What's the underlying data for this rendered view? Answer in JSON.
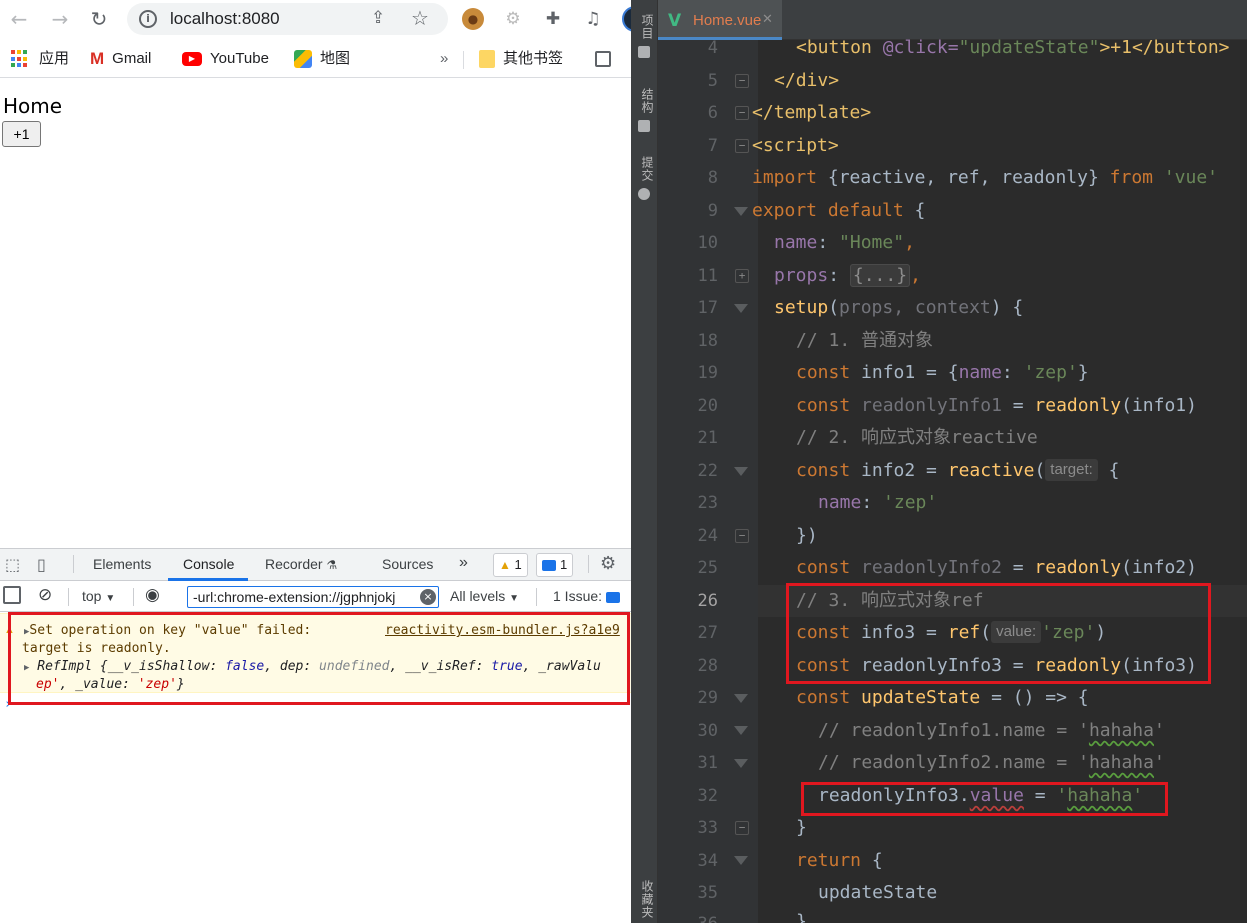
{
  "browser": {
    "url": "localhost:8080",
    "bookmarks": [
      "应用",
      "Gmail",
      "YouTube",
      "地图",
      "其他书签"
    ],
    "overflow_glyph": "»",
    "page": {
      "heading": "Home",
      "button_label": "+1"
    }
  },
  "devtools": {
    "tabs": [
      "Elements",
      "Console",
      "Recorder",
      "Sources"
    ],
    "active_tab": "Console",
    "more_glyph": "»",
    "warnings_count": "1",
    "messages_count": "1",
    "context": "top",
    "filter_value": "-url:chrome-extension://jgphnjokj",
    "levels": "All levels",
    "issues": "1 Issue:",
    "console": {
      "line1": "Set operation on key \"value\" failed:",
      "source": "reactivity.esm-bundler.js?a1e9",
      "line2": "target is readonly.",
      "obj_prefix": "RefImpl {",
      "obj_k1": "__v_isShallow: ",
      "obj_v1": "false",
      "obj_k2": ", dep: ",
      "obj_v2": "undefined",
      "obj_k3": ", __v_isRef: ",
      "obj_v3": "true",
      "obj_k4": ", _rawValu",
      "obj_cont_str": "ep'",
      "obj_cont_k": ", _value: ",
      "obj_cont_v": "'zep'",
      "obj_close": "}"
    }
  },
  "ide": {
    "side_labels": [
      "项目",
      "结构",
      "提交",
      "收藏夹"
    ],
    "file_tab": "Home.vue",
    "line_numbers": [
      "4",
      "5",
      "6",
      "7",
      "8",
      "9",
      "10",
      "11",
      "17",
      "18",
      "19",
      "20",
      "21",
      "22",
      "23",
      "24",
      "25",
      "26",
      "27",
      "28",
      "29",
      "30",
      "31",
      "32",
      "33",
      "34",
      "35",
      "36"
    ],
    "code": {
      "l4_a": "<button ",
      "l4_b": "@click=",
      "l4_c": "\"updateState\"",
      "l4_d": ">+1</",
      "l4_e": "button",
      "l4_f": ">",
      "l5_a": "</",
      "l5_b": "div",
      "l5_c": ">",
      "l6_a": "</",
      "l6_b": "template",
      "l6_c": ">",
      "l7_a": "<",
      "l7_b": "script",
      "l7_c": ">",
      "l8_a": "import",
      "l8_b": " {reactive, ref, readonly} ",
      "l8_c": "from",
      "l8_d": " 'vue'",
      "l9_a": "export default",
      "l9_b": " {",
      "l10_a": "name",
      "l10_b": ": ",
      "l10_c": "\"Home\"",
      "l10_d": ",",
      "l11_a": "props",
      "l11_b": ": ",
      "l11_c": "{...}",
      "l11_d": ",",
      "l17_a": "setup",
      "l17_b": "(",
      "l17_c": "props, context",
      "l17_d": ") {",
      "l18": "// 1. 普通对象",
      "l19_a": "const",
      "l19_b": " info1 = {",
      "l19_c": "name",
      "l19_d": ": ",
      "l19_e": "'zep'",
      "l19_f": "}",
      "l20_a": "const",
      "l20_b": " readonlyInfo1",
      "l20_c": " = ",
      "l20_d": "readonly",
      "l20_e": "(info1)",
      "l21": "// 2. 响应式对象reactive",
      "l22_a": "const",
      "l22_b": " info2 = ",
      "l22_c": "reactive",
      "l22_d": "(",
      "l22_hint": "target:",
      "l22_e": " {",
      "l23_a": "name",
      "l23_b": ": ",
      "l23_c": "'zep'",
      "l24": "})",
      "l25_a": "const",
      "l25_b": " readonlyInfo2",
      "l25_c": " = ",
      "l25_d": "readonly",
      "l25_e": "(info2)",
      "l26": "// 3. 响应式对象ref",
      "l27_a": "const",
      "l27_b": " info3 = ",
      "l27_c": "ref",
      "l27_d": "(",
      "l27_hint": "value:",
      "l27_e": "'zep'",
      "l27_f": ")",
      "l28_a": "const",
      "l28_b": " readonlyInfo3 = ",
      "l28_c": "readonly",
      "l28_d": "(info3)",
      "l29_a": "const",
      "l29_b": " ",
      "l29_c": "updateState",
      "l29_d": " = () => {",
      "l30_a": "// readonlyInfo1.name = '",
      "l30_b": "hahaha",
      "l30_c": "'",
      "l31_a": "// readonlyInfo2.name = '",
      "l31_b": "hahaha",
      "l31_c": "'",
      "l32_a": "readonlyInfo3.",
      "l32_b": "value",
      "l32_c": " = ",
      "l32_d": "'",
      "l32_e": "hahaha",
      "l32_f": "'",
      "l33": "}",
      "l34_a": "return",
      "l34_b": " {",
      "l35": "updateState",
      "l36": "}"
    }
  }
}
